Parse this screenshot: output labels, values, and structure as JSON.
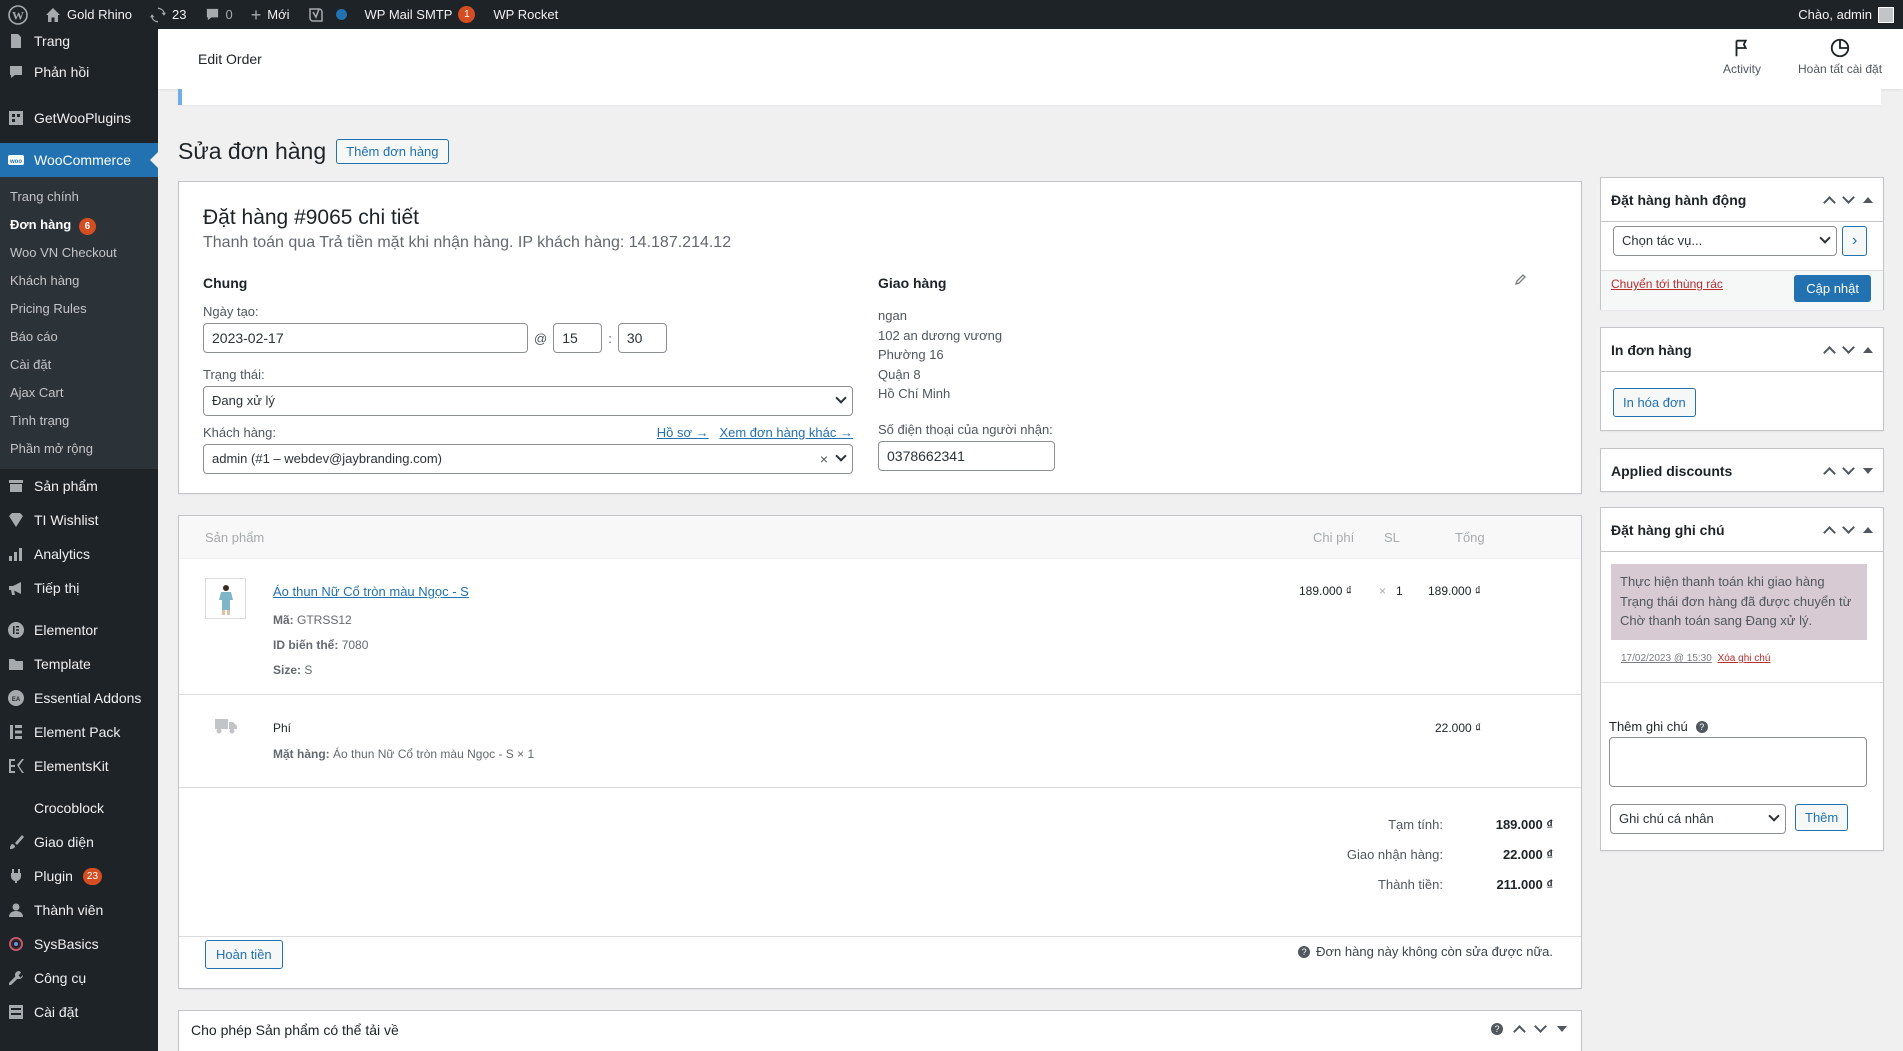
{
  "adminbar": {
    "site_name": "Gold Rhino",
    "updates_count": "23",
    "comments_count": "0",
    "new_label": "Mới",
    "wp_mail_smtp": "WP Mail SMTP",
    "wp_mail_smtp_badge": "1",
    "wp_rocket": "WP Rocket",
    "greeting": "Chào, admin"
  },
  "sidebar": {
    "top_items": [
      {
        "label": "Trang",
        "icon": "page-icon"
      },
      {
        "label": "Phản hồi",
        "icon": "comment-icon"
      },
      {
        "label": "GetWooPlugins",
        "icon": "plugin-grid-icon"
      }
    ],
    "woocommerce": "WooCommerce",
    "submenu": [
      "Trang chính",
      "Đơn hàng",
      "Woo VN Checkout",
      "Khách hàng",
      "Pricing Rules",
      "Báo cáo",
      "Cài đặt",
      "Ajax Cart",
      "Tình trạng",
      "Phần mở rộng"
    ],
    "orders_badge": "6",
    "bottom_items": [
      {
        "label": "Sản phẩm"
      },
      {
        "label": "TI Wishlist"
      },
      {
        "label": "Analytics"
      },
      {
        "label": "Tiếp thị"
      },
      {
        "label": "Elementor"
      },
      {
        "label": "Template"
      },
      {
        "label": "Essential Addons"
      },
      {
        "label": "Element Pack"
      },
      {
        "label": "ElementsKit"
      },
      {
        "label": "Crocoblock"
      },
      {
        "label": "Giao diện"
      },
      {
        "label": "Plugin"
      },
      {
        "label": "Thành viên"
      },
      {
        "label": "SysBasics"
      },
      {
        "label": "Công cụ"
      },
      {
        "label": "Cài đặt"
      }
    ],
    "plugin_badge": "23"
  },
  "header": {
    "title": "Edit Order",
    "activity": "Activity",
    "finish_setup": "Hoàn tất cài đặt"
  },
  "page": {
    "title": "Sửa đơn hàng",
    "add_order": "Thêm đơn hàng"
  },
  "order": {
    "heading": "Đặt hàng #9065 chi tiết",
    "meta": "Thanh toán qua Trả tiền mặt khi nhận hàng. IP khách hàng: 14.187.214.12",
    "general_title": "Chung",
    "date_label": "Ngày tạo:",
    "date": "2023-02-17",
    "at": "@",
    "hour": "15",
    "minute": "30",
    "time_sep": ":",
    "status_label": "Trạng thái:",
    "status": "Đang xử lý",
    "customer_label": "Khách hàng:",
    "profile_link": "Hồ sơ →",
    "other_orders_link": "Xem đơn hàng khác →",
    "customer": "admin (#1 – webdev@jaybranding.com)",
    "clear": "×",
    "shipping_title": "Giao hàng",
    "ship_lines": [
      "ngan",
      "102 an dương vương",
      "Phường 16",
      "Quận 8",
      "Hồ Chí Minh"
    ],
    "phone_label": "Số điện thoại của người nhận:",
    "phone": "0378662341"
  },
  "items": {
    "col_product": "Sản phẩm",
    "col_cost": "Chi phí",
    "col_qty": "SL",
    "col_total": "Tổng",
    "product_name": "Áo thun Nữ Cổ tròn màu Ngọc - S",
    "sku_label": "Mã:",
    "sku": "GTRSS12",
    "variation_label": "ID biến thể:",
    "variation": "7080",
    "size_label": "Size:",
    "size": "S",
    "cost": "189.000 ₫",
    "qty_x": "×",
    "qty": "1",
    "line_total": "189.000 ₫",
    "fee_label": "Phí",
    "fee_items_label": "Mặt hàng:",
    "fee_items": "Áo thun Nữ Cổ tròn màu Ngọc - S × 1",
    "fee_total": "22.000 ₫",
    "subtotal_label": "Tạm tính:",
    "subtotal": "189.000 ₫",
    "shipping_label": "Giao nhận hàng:",
    "shipping": "22.000 ₫",
    "total_label": "Thành tiền:",
    "total": "211.000 ₫",
    "refund": "Hoàn tiền",
    "locked_note": "Đơn hàng này không còn sửa được nữa."
  },
  "downloads": {
    "title": "Cho phép Sản phẩm có thể tải về"
  },
  "actions_box": {
    "title": "Đặt hàng hành động",
    "select": "Chọn tác vụ...",
    "go": "›",
    "trash": "Chuyển tới thùng rác",
    "update": "Cập nhật"
  },
  "print_box": {
    "title": "In đơn hàng",
    "invoice": "In hóa đơn"
  },
  "discounts_box": {
    "title": "Applied discounts"
  },
  "notes_box": {
    "title": "Đặt hàng ghi chú",
    "note_lines": [
      "Thực hiện thanh toán khi giao hàng",
      "Trạng thái đơn hàng đã được chuyển từ",
      "Chờ thanh toán sang Đang xử lý."
    ],
    "note_date": "17/02/2023 @ 15:30",
    "delete_note": "Xóa ghi chú",
    "add_note_label": "Thêm ghi chú",
    "help": "?",
    "note_type": "Ghi chú cá nhân",
    "add": "Thêm"
  },
  "colors": {
    "accent": "#2271b1",
    "admin_dark": "#1d2327",
    "note_bg": "#d7cad2",
    "danger": "#b32d2e"
  }
}
